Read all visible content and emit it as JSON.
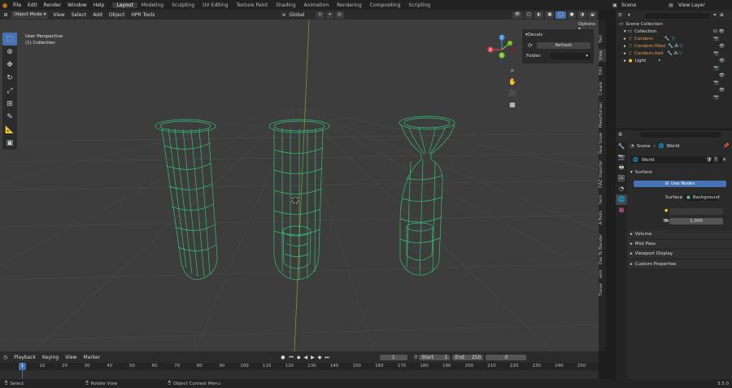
{
  "menu": [
    "File",
    "Edit",
    "Render",
    "Window",
    "Help"
  ],
  "workspaces": [
    "Layout",
    "Modeling",
    "Sculpting",
    "UV Editing",
    "Texture Paint",
    "Shading",
    "Animation",
    "Rendering",
    "Compositing",
    "Scripting"
  ],
  "active_workspace": "Layout",
  "scene_name": "Scene",
  "view_layer": "View Layer",
  "header": {
    "mode": "Object Mode",
    "menus": [
      "View",
      "Select",
      "Add",
      "Object",
      "HPR Tools"
    ],
    "orientation": "Global",
    "options": "Options"
  },
  "viewport": {
    "perspective": "User Perspective",
    "collection": "(1) Collection",
    "gizmo_axes": {
      "z": "Z",
      "y": "Y",
      "x": "X"
    }
  },
  "npanel": {
    "title": "Decals",
    "refresh": "Refresh",
    "folder_label": "Folder:"
  },
  "side_tabs": [
    "Tool",
    "View",
    "Edit",
    "Create",
    "MakeHuman",
    "Real Snow",
    "DAZ Importer",
    "Item",
    "A-Tools",
    "Daz To Blender",
    "osm",
    "Tissue"
  ],
  "outliner": {
    "root": "Scene Collection",
    "collection": "Collection",
    "items": [
      "Condom",
      "Condom.filled",
      "Condom.tied",
      "Light"
    ]
  },
  "properties": {
    "breadcrumb_scene": "Scene",
    "breadcrumb_world": "World",
    "world_name": "World",
    "surface_title": "Surface",
    "use_nodes": "Use Nodes",
    "surface_label": "Surface",
    "surface_value": "Background",
    "color_label": "Color",
    "strength_label": "Strength",
    "strength_value": "1.000",
    "panels": [
      "Volume",
      "Mist Pass",
      "Viewport Display",
      "Custom Properties"
    ]
  },
  "timeline": {
    "menus": [
      "Playback",
      "Keying",
      "View",
      "Marker"
    ],
    "current_frame": "1",
    "start_label": "Start",
    "start": "1",
    "end_label": "End",
    "end": "250",
    "right_value": "0",
    "ticks": [
      "1",
      "10",
      "20",
      "30",
      "40",
      "50",
      "60",
      "70",
      "80",
      "90",
      "100",
      "110",
      "120",
      "130",
      "140",
      "150",
      "160",
      "170",
      "180",
      "190",
      "200",
      "210",
      "220",
      "230",
      "240",
      "250"
    ],
    "playhead": "1"
  },
  "status": {
    "select": "Select",
    "rotate": "Rotate View",
    "context": "Object Context Menu",
    "version": "3.5.0"
  },
  "colors": {
    "wire": "#33c07a",
    "accent": "#4772b3",
    "x_axis": "#e0434f",
    "y_axis": "#7fbf2a",
    "z_axis": "#3b86d6"
  }
}
